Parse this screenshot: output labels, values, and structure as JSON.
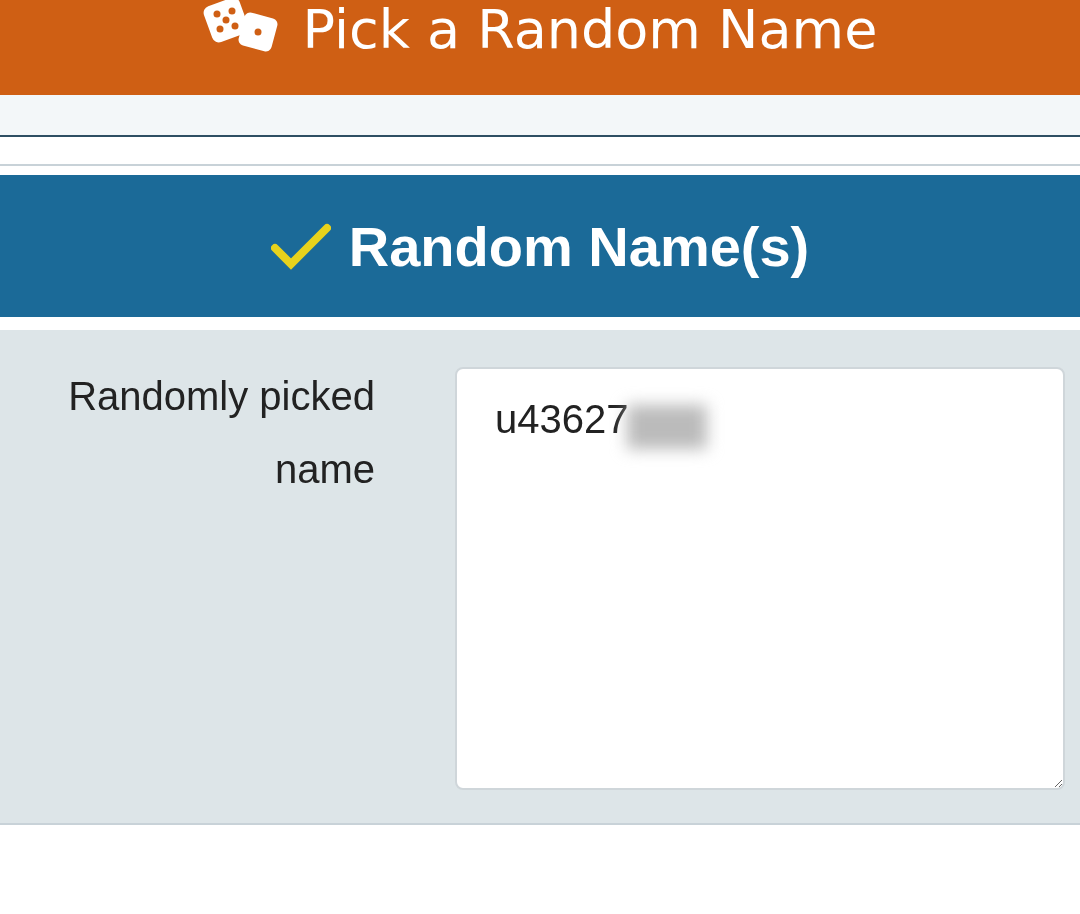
{
  "header": {
    "title": "Pick a Random Name"
  },
  "result": {
    "title": "Random Name(s)",
    "label": "Randomly picked name",
    "value": "u43627"
  }
}
